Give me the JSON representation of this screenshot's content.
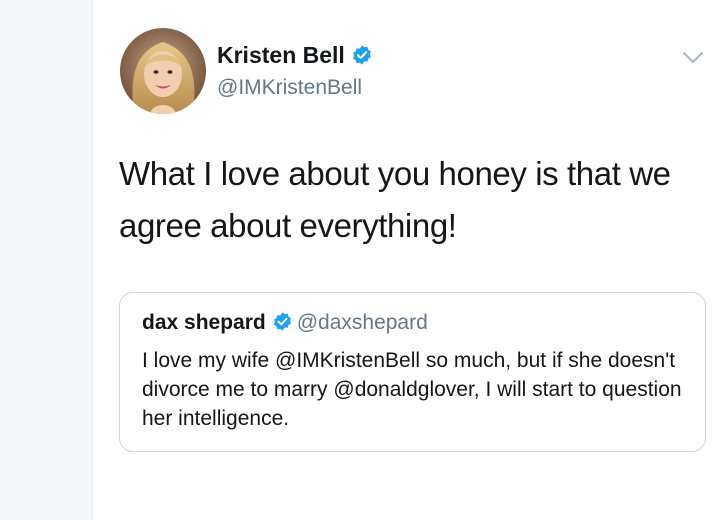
{
  "author": {
    "name": "Kristen Bell",
    "handle": "@IMKristenBell",
    "verified_icon": "verified-badge-icon",
    "avatar_icon": "avatar-photo"
  },
  "tweet": {
    "text": "What I love about you honey is that we agree about everything!",
    "menu_icon": "chevron-down-icon"
  },
  "quoted_tweet": {
    "name": "dax shepard",
    "handle": "@daxshepard",
    "text": "I love my wife @IMKristenBell so much, but if she doesn't divorce me to marry @donaldglover, I will start to question her intelligence."
  },
  "colors": {
    "verified_blue": "#1da1f2",
    "text_primary": "#14171a",
    "text_secondary": "#657786",
    "border": "#ccd6dd"
  }
}
